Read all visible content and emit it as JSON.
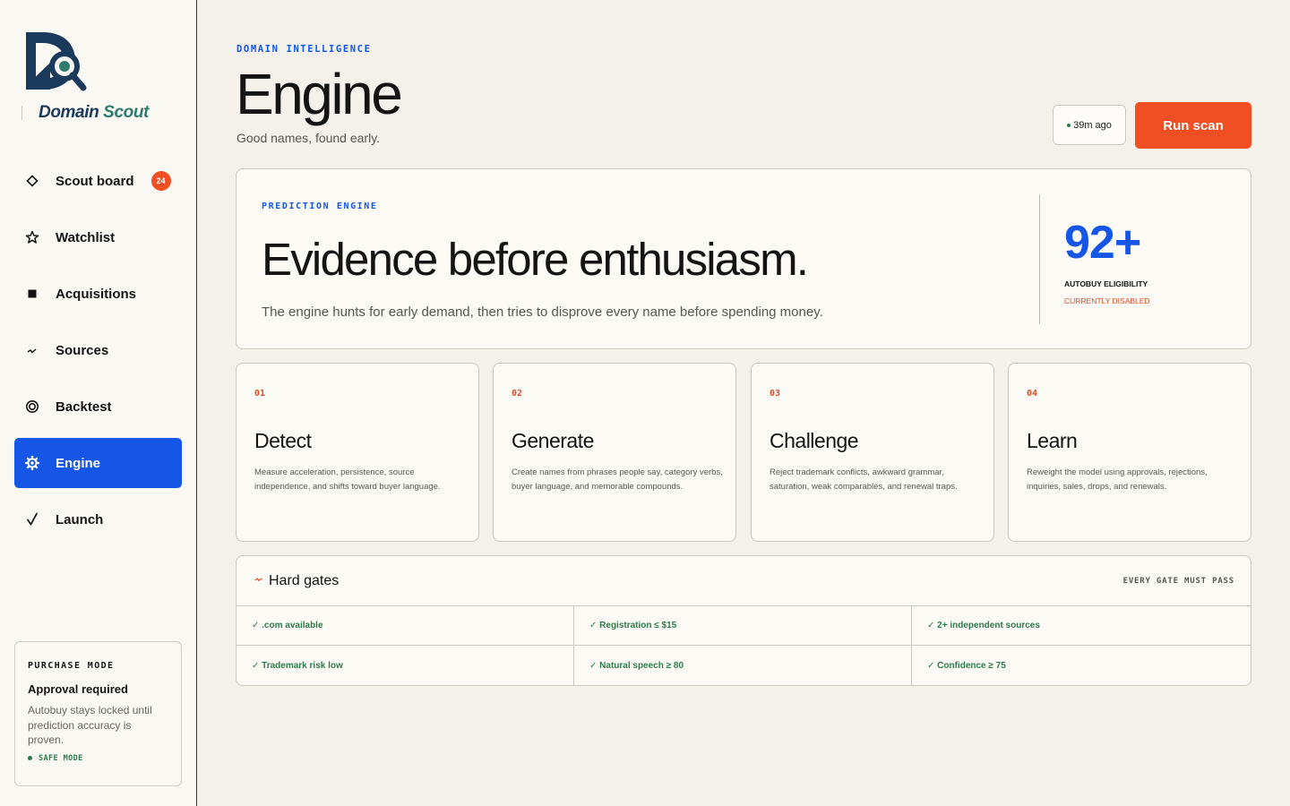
{
  "brand": {
    "name_part1": "Domain",
    "name_part2": "Scout"
  },
  "sidebar": {
    "items": [
      {
        "label": "Scout board",
        "icon": "diamond-icon",
        "badge": "24",
        "active": false
      },
      {
        "label": "Watchlist",
        "icon": "star-icon",
        "active": false
      },
      {
        "label": "Acquisitions",
        "icon": "square-icon",
        "active": false
      },
      {
        "label": "Sources",
        "icon": "signal-icon",
        "active": false
      },
      {
        "label": "Backtest",
        "icon": "target-icon",
        "active": false
      },
      {
        "label": "Engine",
        "icon": "gear-icon",
        "active": true
      },
      {
        "label": "Launch",
        "icon": "check-icon",
        "active": false
      }
    ],
    "purchase_mode": {
      "label": "PURCHASE MODE",
      "title": "Approval required",
      "description": "Autobuy stays locked until prediction accuracy is proven.",
      "status": "SAFE MODE"
    }
  },
  "header": {
    "eyebrow": "DOMAIN INTELLIGENCE",
    "title": "Engine",
    "subtitle": "Good names, found early.",
    "last_scan": "39m ago",
    "run_button": "Run scan"
  },
  "hero": {
    "eyebrow": "PREDICTION ENGINE",
    "title": "Evidence before enthusiasm.",
    "description": "The engine hunts for early demand, then tries to disprove every name before spending money.",
    "stat_value": "92+",
    "stat_label": "AUTOBUY ELIGIBILITY",
    "stat_status": "CURRENTLY DISABLED"
  },
  "steps": [
    {
      "number": "01",
      "title": "Detect",
      "description": "Measure acceleration, persistence, source independence, and shifts toward buyer language."
    },
    {
      "number": "02",
      "title": "Generate",
      "description": "Create names from phrases people say, category verbs, buyer language, and memorable compounds."
    },
    {
      "number": "03",
      "title": "Challenge",
      "description": "Reject trademark conflicts, awkward grammar, saturation, weak comparables, and renewal traps."
    },
    {
      "number": "04",
      "title": "Learn",
      "description": "Reweight the model using approvals, rejections, inquiries, sales, drops, and renewals."
    }
  ],
  "gates": {
    "title": "Hard gates",
    "note": "EVERY GATE MUST PASS",
    "items": [
      "✓ .com available",
      "✓ Registration ≤ $15",
      "✓ 2+ independent sources",
      "✓ Trademark risk low",
      "✓ Natural speech ≥ 80",
      "✓ Confidence ≥ 75"
    ]
  },
  "colors": {
    "accent_blue": "#1556e6",
    "accent_orange": "#f04e23",
    "success_green": "#2e7a4c",
    "brand_navy": "#1a3a5c",
    "brand_teal": "#2f7b6d"
  }
}
